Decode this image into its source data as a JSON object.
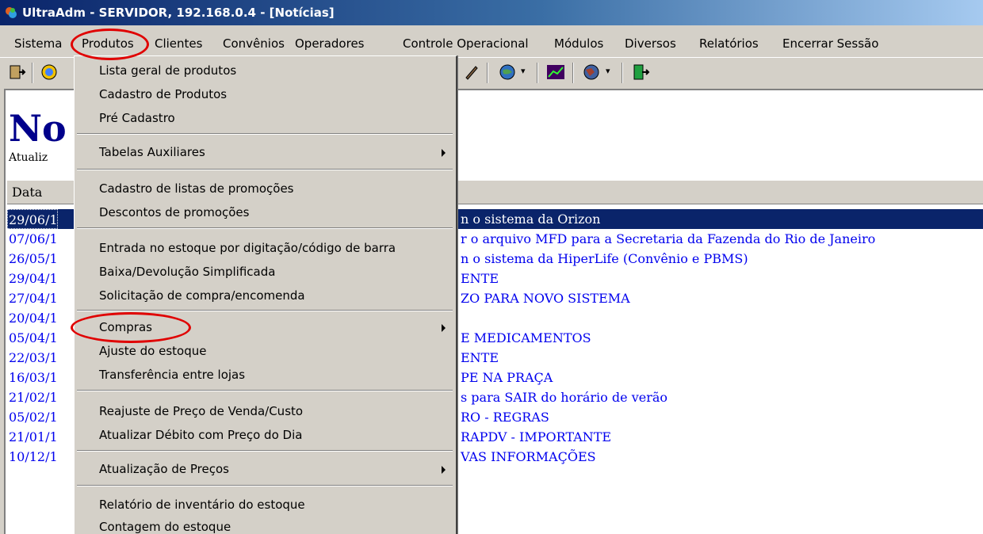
{
  "window": {
    "title": "UltraAdm - SERVIDOR, 192.168.0.4 - [Notícias]"
  },
  "menubar": {
    "items": [
      "Sistema",
      "Produtos",
      "Clientes",
      "Convênios",
      "Operadores",
      "Controle Operacional",
      "Módulos",
      "Diversos",
      "Relatórios",
      "Encerrar Sessão"
    ]
  },
  "news": {
    "title": "No",
    "subtitle": "Atualiz",
    "column_date": "Data",
    "rows": [
      {
        "date": "29/06/1",
        "text": "n o sistema da Orizon"
      },
      {
        "date": "07/06/1",
        "text": "r o arquivo MFD para a Secretaria da Fazenda do Rio de Janeiro"
      },
      {
        "date": "26/05/1",
        "text": "n o sistema da HiperLife (Convênio e PBMS)"
      },
      {
        "date": "29/04/1",
        "text": "ENTE"
      },
      {
        "date": "27/04/1",
        "text": "ZO PARA NOVO SISTEMA"
      },
      {
        "date": "20/04/1",
        "text": ""
      },
      {
        "date": "05/04/1",
        "text": "E MEDICAMENTOS"
      },
      {
        "date": "22/03/1",
        "text": "ENTE"
      },
      {
        "date": "16/03/1",
        "text": "PE NA PRAÇA"
      },
      {
        "date": "21/02/1",
        "text": "s para SAIR do horário de verão"
      },
      {
        "date": "05/02/1",
        "text": "RO - REGRAS"
      },
      {
        "date": "21/01/1",
        "text": "RAPDV - IMPORTANTE"
      },
      {
        "date": "10/12/1",
        "text": "VAS INFORMAÇÕES"
      }
    ]
  },
  "produtos_menu": {
    "items": [
      "Lista geral de produtos",
      "Cadastro de Produtos",
      "Pré Cadastro",
      "Tabelas Auxiliares",
      "Cadastro de listas de promoções",
      "Descontos de promoções",
      "Entrada no estoque por digitação/código de barra",
      "Baixa/Devolução Simplificada",
      "Solicitação de compra/encomenda",
      "Compras",
      "Ajuste do estoque",
      "Transferência entre lojas",
      "Reajuste de Preço de Venda/Custo",
      "Atualizar Débito com Preço do Dia",
      "Atualização de Preços",
      "Relatório de inventário do estoque",
      "Contagem do estoque"
    ]
  },
  "colors": {
    "highlight": "#e00000",
    "selection": "#0a246a",
    "link": "#0000ee",
    "title": "#00008b"
  }
}
